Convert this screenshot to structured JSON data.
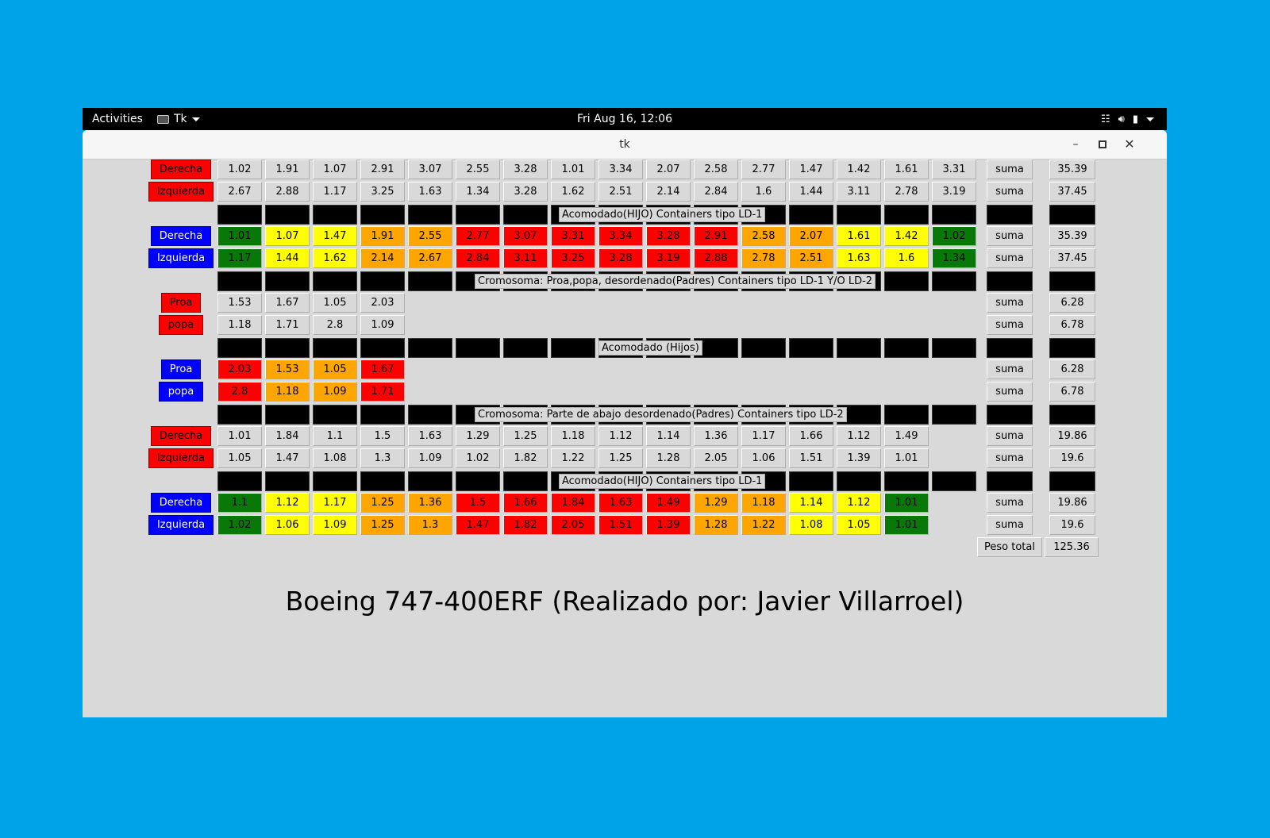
{
  "topbar": {
    "activities": "Activities",
    "app_name": "Tk",
    "clock": "Fri Aug 16, 12:06"
  },
  "window": {
    "title": "tk"
  },
  "labels": {
    "derecha": "Derecha",
    "izquierda": "Izquierda",
    "proa": "Proa",
    "popa": "popa",
    "suma": "suma",
    "peso_total": "Peso total"
  },
  "headers": [
    "Acomodado(HIJO) Containers tipo LD-1",
    "Cromosoma: Proa,popa, desordenado(Padres)  Containers tipo LD-1 Y/O LD-2",
    "Acomodado (Hijos)",
    "Cromosoma: Parte de abajo desordenado(Padres)  Containers tipo LD-2",
    "Acomodado(HIJO) Containers tipo LD-1"
  ],
  "rows": [
    {
      "side": "Derecha",
      "sideColor": "red",
      "values": [
        "1.02",
        "1.91",
        "1.07",
        "2.91",
        "3.07",
        "2.55",
        "3.28",
        "1.01",
        "3.34",
        "2.07",
        "2.58",
        "2.77",
        "1.47",
        "1.42",
        "1.61",
        "3.31"
      ],
      "colors": [],
      "total": "35.39"
    },
    {
      "side": "Izquierda",
      "sideColor": "red",
      "values": [
        "2.67",
        "2.88",
        "1.17",
        "3.25",
        "1.63",
        "1.34",
        "3.28",
        "1.62",
        "2.51",
        "2.14",
        "2.84",
        "1.6",
        "1.44",
        "3.11",
        "2.78",
        "3.19"
      ],
      "colors": [],
      "total": "37.45"
    },
    {
      "side": "Derecha",
      "sideColor": "blue",
      "values": [
        "1.01",
        "1.07",
        "1.47",
        "1.91",
        "2.55",
        "2.77",
        "3.07",
        "3.31",
        "3.34",
        "3.28",
        "2.91",
        "2.58",
        "2.07",
        "1.61",
        "1.42",
        "1.02"
      ],
      "colors": [
        "green",
        "yellow",
        "yellow",
        "orange",
        "orange",
        "red",
        "red",
        "red",
        "red",
        "red",
        "red",
        "orange",
        "orange",
        "yellow",
        "yellow",
        "green"
      ],
      "total": "35.39"
    },
    {
      "side": "Izquierda",
      "sideColor": "blue",
      "values": [
        "1.17",
        "1.44",
        "1.62",
        "2.14",
        "2.67",
        "2.84",
        "3.11",
        "3.25",
        "3.28",
        "3.19",
        "2.88",
        "2.78",
        "2.51",
        "1.63",
        "1.6",
        "1.34"
      ],
      "colors": [
        "green",
        "yellow",
        "yellow",
        "orange",
        "orange",
        "red",
        "red",
        "red",
        "red",
        "red",
        "red",
        "orange",
        "orange",
        "yellow",
        "yellow",
        "green"
      ],
      "total": "37.45"
    },
    {
      "side": "Proa",
      "sideColor": "red",
      "values": [
        "1.53",
        "1.67",
        "1.05",
        "2.03"
      ],
      "colors": [],
      "total": "6.28"
    },
    {
      "side": "popa",
      "sideColor": "red",
      "values": [
        "1.18",
        "1.71",
        "2.8",
        "1.09"
      ],
      "colors": [],
      "total": "6.78"
    },
    {
      "side": "Proa",
      "sideColor": "blue",
      "values": [
        "2.03",
        "1.53",
        "1.05",
        "1.67"
      ],
      "colors": [
        "red",
        "orange",
        "orange",
        "red"
      ],
      "total": "6.28"
    },
    {
      "side": "popa",
      "sideColor": "blue",
      "values": [
        "2.8",
        "1.18",
        "1.09",
        "1.71"
      ],
      "colors": [
        "red",
        "orange",
        "orange",
        "red"
      ],
      "total": "6.78"
    },
    {
      "side": "Derecha",
      "sideColor": "red",
      "values": [
        "1.01",
        "1.84",
        "1.1",
        "1.5",
        "1.63",
        "1.29",
        "1.25",
        "1.18",
        "1.12",
        "1.14",
        "1.36",
        "1.17",
        "1.66",
        "1.12",
        "1.49"
      ],
      "colors": [],
      "total": "19.86"
    },
    {
      "side": "Izquierda",
      "sideColor": "red",
      "values": [
        "1.05",
        "1.47",
        "1.08",
        "1.3",
        "1.09",
        "1.02",
        "1.82",
        "1.22",
        "1.25",
        "1.28",
        "2.05",
        "1.06",
        "1.51",
        "1.39",
        "1.01"
      ],
      "colors": [],
      "total": "19.6"
    },
    {
      "side": "Derecha",
      "sideColor": "blue",
      "values": [
        "1.1",
        "1.12",
        "1.17",
        "1.25",
        "1.36",
        "1.5",
        "1.66",
        "1.84",
        "1.63",
        "1.49",
        "1.29",
        "1.18",
        "1.14",
        "1.12",
        "1.01"
      ],
      "colors": [
        "green",
        "yellow",
        "yellow",
        "orange",
        "orange",
        "red",
        "red",
        "red",
        "red",
        "red",
        "orange",
        "orange",
        "yellow",
        "yellow",
        "green"
      ],
      "total": "19.86"
    },
    {
      "side": "Izquierda",
      "sideColor": "blue",
      "values": [
        "1.02",
        "1.06",
        "1.09",
        "1.25",
        "1.3",
        "1.47",
        "1.82",
        "2.05",
        "1.51",
        "1.39",
        "1.28",
        "1.22",
        "1.08",
        "1.05",
        "1.01"
      ],
      "colors": [
        "green",
        "yellow",
        "yellow",
        "orange",
        "orange",
        "red",
        "red",
        "red",
        "red",
        "red",
        "orange",
        "orange",
        "yellow",
        "yellow",
        "green"
      ],
      "total": "19.6"
    }
  ],
  "peso_total": "125.36",
  "footer_title": "Boeing 747-400ERF (Realizado por: Javier Villarroel)"
}
